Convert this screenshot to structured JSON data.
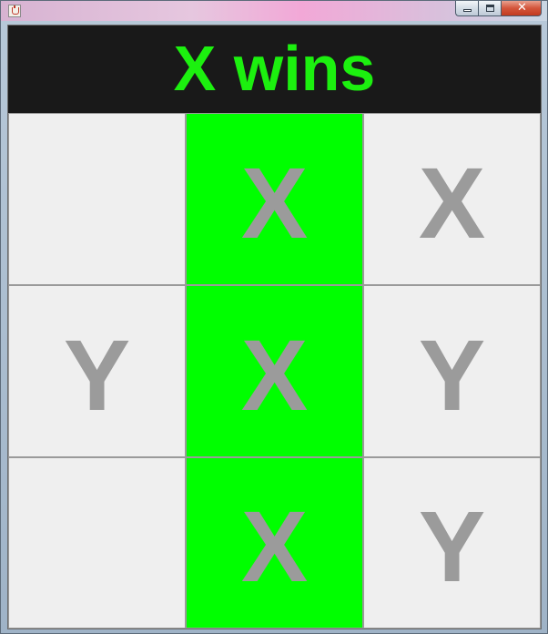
{
  "window": {
    "title": "",
    "controls": [
      "minimize-icon",
      "maximize-icon",
      "close-icon"
    ],
    "close_glyph": "✕"
  },
  "status": {
    "text": "X wins",
    "color": "#1cf00f"
  },
  "board": {
    "cells": [
      {
        "mark": "",
        "winning": false
      },
      {
        "mark": "X",
        "winning": true
      },
      {
        "mark": "X",
        "winning": false
      },
      {
        "mark": "Y",
        "winning": false
      },
      {
        "mark": "X",
        "winning": true
      },
      {
        "mark": "Y",
        "winning": false
      },
      {
        "mark": "",
        "winning": false
      },
      {
        "mark": "X",
        "winning": true
      },
      {
        "mark": "Y",
        "winning": false
      }
    ],
    "win_color": "#00ff00",
    "mark_color": "#9b9b9b"
  }
}
